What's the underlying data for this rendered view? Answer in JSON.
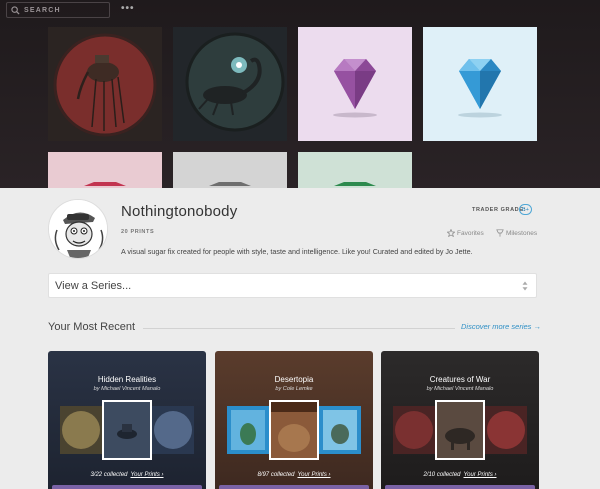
{
  "header": {
    "search_placeholder": "SEARCH",
    "more_label": "•••"
  },
  "banner": {
    "tiles": [
      {
        "name": "elephant-tile",
        "kind": "artwork"
      },
      {
        "name": "scorpion-tile",
        "kind": "artwork"
      },
      {
        "name": "purple-gem-tile",
        "kind": "gem",
        "color": "#a05aab"
      },
      {
        "name": "blue-gem-tile",
        "kind": "gem",
        "color": "#3aa0dc"
      },
      {
        "name": "pink-gem-tile",
        "kind": "gem",
        "color": "#c23450"
      },
      {
        "name": "gray-gem-tile",
        "kind": "gem",
        "color": "#6e6e6e"
      },
      {
        "name": "green-gem-tile",
        "kind": "gem",
        "color": "#2d8a4e"
      }
    ]
  },
  "profile": {
    "name": "Nothingtonobody",
    "prints": "20 PRINTS",
    "trader_grade_label": "TRADER GRADE:",
    "trader_grade": "B+",
    "favorites_label": "Favorites",
    "milestones_label": "Milestones",
    "bio": "A visual sugar fix created for people with style, taste and intelligence. Like you! Curated and edited by Jo Jette."
  },
  "series_select": {
    "selected": "View a Series..."
  },
  "recent": {
    "title": "Your Most Recent",
    "discover_link": "Discover more series →",
    "cards": [
      {
        "title": "Hidden Realities",
        "author": "by Michael Vincent Manalo",
        "collected": "3/22 collected",
        "link": "Your Prints ›"
      },
      {
        "title": "Desertopia",
        "author": "by Cole Lemke",
        "collected": "8/97 collected",
        "link": "Your Prints ›"
      },
      {
        "title": "Creatures of War",
        "author": "by Michael Vincent Manalo",
        "collected": "2/10 collected",
        "link": "Your Prints ›"
      }
    ]
  },
  "colors": {
    "accent": "#2e8fc5",
    "card_bar": "#7a62a6",
    "banner_bg": "#1f1a1c",
    "page_bg": "#ececec"
  }
}
